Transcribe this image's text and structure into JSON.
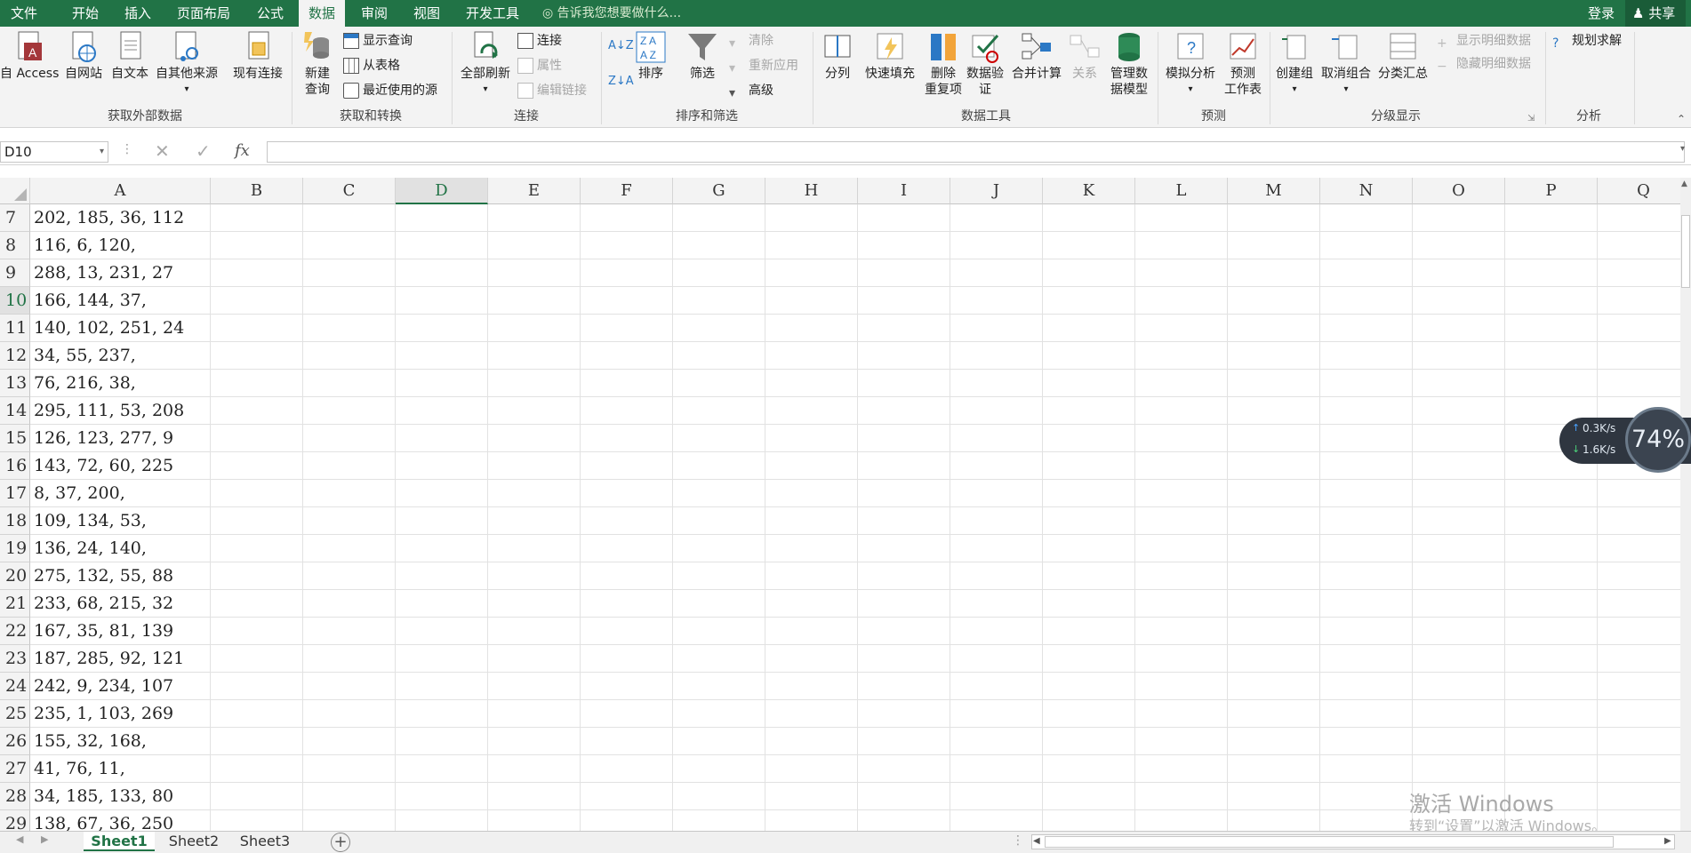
{
  "menubar": {
    "tabs": [
      {
        "label": "文件"
      },
      {
        "label": "开始"
      },
      {
        "label": "插入"
      },
      {
        "label": "页面布局"
      },
      {
        "label": "公式"
      },
      {
        "label": "数据"
      },
      {
        "label": "审阅"
      },
      {
        "label": "视图"
      },
      {
        "label": "开发工具"
      }
    ],
    "active_tab": "数据",
    "tell_me": "告诉我您想要做什么...",
    "login": "登录",
    "share": "共享"
  },
  "ribbon": {
    "get_external": {
      "group": "获取外部数据",
      "access": "自 Access",
      "web": "自网站",
      "text": "自文本",
      "other": "自其他来源",
      "existing": "现有连接"
    },
    "get_transform": {
      "group": "获取和转换",
      "new_query": "新建\n查询",
      "show_query": "显示查询",
      "from_table": "从表格",
      "recent_sources": "最近使用的源"
    },
    "connections": {
      "group": "连接",
      "refresh_all": "全部刷新",
      "connections": "连接",
      "properties": "属性",
      "edit_links": "编辑链接"
    },
    "sort_filter": {
      "group": "排序和筛选",
      "sort": "排序",
      "filter": "筛选",
      "clear": "清除",
      "reapply": "重新应用",
      "advanced": "高级"
    },
    "data_tools": {
      "group": "数据工具",
      "text_to_columns": "分列",
      "flash_fill": "快速填充",
      "remove_dup": "删除\n重复项",
      "validation": "数据验\n证",
      "consolidate": "合并计算",
      "relationships": "关系",
      "data_model": "管理数\n据模型"
    },
    "forecast": {
      "group": "预测",
      "what_if": "模拟分析",
      "forecast_sheet": "预测\n工作表"
    },
    "outline": {
      "group": "分级显示",
      "group_btn": "创建组",
      "ungroup": "取消组合",
      "subtotal": "分类汇总",
      "show_detail": "显示明细数据",
      "hide_detail": "隐藏明细数据"
    },
    "analysis": {
      "group": "分析",
      "solver": "规划求解"
    }
  },
  "formula_bar": {
    "name_box": "D10",
    "fx": "fx",
    "content": ""
  },
  "grid": {
    "columns": [
      "A",
      "B",
      "C",
      "D",
      "E",
      "F",
      "G",
      "H",
      "I",
      "J",
      "K",
      "L",
      "M",
      "N",
      "O",
      "P",
      "Q"
    ],
    "selected_column": "D",
    "selected_row": "10",
    "rows": [
      {
        "num": "7",
        "a": "202, 185, 36, 112"
      },
      {
        "num": "8",
        "a": "116, 6, 120,"
      },
      {
        "num": "9",
        "a": "288, 13, 231, 27"
      },
      {
        "num": "10",
        "a": "166, 144, 37,"
      },
      {
        "num": "11",
        "a": "140, 102, 251, 24"
      },
      {
        "num": "12",
        "a": "34, 55, 237,"
      },
      {
        "num": "13",
        "a": "76, 216, 38,"
      },
      {
        "num": "14",
        "a": "295, 111, 53, 208"
      },
      {
        "num": "15",
        "a": "126, 123, 277, 9"
      },
      {
        "num": "16",
        "a": "143, 72, 60, 225"
      },
      {
        "num": "17",
        "a": "8, 37, 200,"
      },
      {
        "num": "18",
        "a": "109, 134, 53,"
      },
      {
        "num": "19",
        "a": "136, 24, 140,"
      },
      {
        "num": "20",
        "a": "275, 132, 55, 88"
      },
      {
        "num": "21",
        "a": "233, 68, 215, 32"
      },
      {
        "num": "22",
        "a": "167, 35, 81, 139"
      },
      {
        "num": "23",
        "a": "187, 285, 92, 121"
      },
      {
        "num": "24",
        "a": "242, 9, 234, 107"
      },
      {
        "num": "25",
        "a": "235, 1, 103, 269"
      },
      {
        "num": "26",
        "a": "155, 32, 168,"
      },
      {
        "num": "27",
        "a": "41, 76, 11,"
      },
      {
        "num": "28",
        "a": "34, 185, 133, 80"
      },
      {
        "num": "29",
        "a": "138, 67, 36, 250"
      }
    ]
  },
  "sheets": [
    {
      "label": "Sheet1"
    },
    {
      "label": "Sheet2"
    },
    {
      "label": "Sheet3"
    }
  ],
  "active_sheet": "Sheet1",
  "net_widget": {
    "up": "0.3K/s",
    "down": "1.6K/s",
    "percent": "74%"
  },
  "watermark": {
    "line1": "激活 Windows",
    "line2": "转到“设置”以激活 Windows。"
  },
  "colors": {
    "accent": "#217346"
  }
}
